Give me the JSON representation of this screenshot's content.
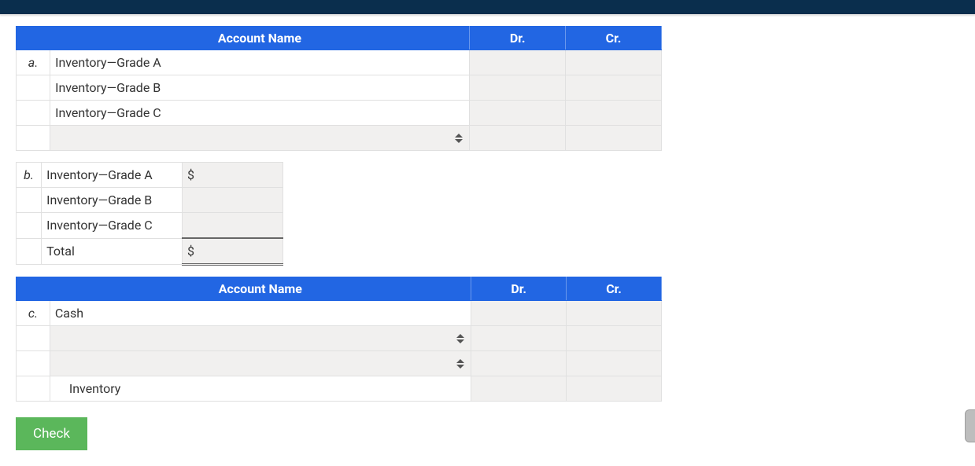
{
  "columns": {
    "account": "Account Name",
    "dr": "Dr.",
    "cr": "Cr."
  },
  "section_a": {
    "label": "a.",
    "rows": [
      {
        "name": "Inventory—Grade A"
      },
      {
        "name": "Inventory—Grade B"
      },
      {
        "name": "Inventory—Grade C"
      }
    ]
  },
  "section_b": {
    "label": "b.",
    "rows": [
      {
        "name": "Inventory—Grade A",
        "prefix": "$"
      },
      {
        "name": "Inventory—Grade B",
        "prefix": ""
      },
      {
        "name": "Inventory—Grade C",
        "prefix": ""
      }
    ],
    "total_label": "Total",
    "total_prefix": "$"
  },
  "section_c": {
    "label": "c.",
    "rows": [
      {
        "name": "Cash",
        "indent": false
      },
      {
        "name": "Inventory",
        "indent": true
      }
    ]
  },
  "buttons": {
    "check": "Check"
  }
}
